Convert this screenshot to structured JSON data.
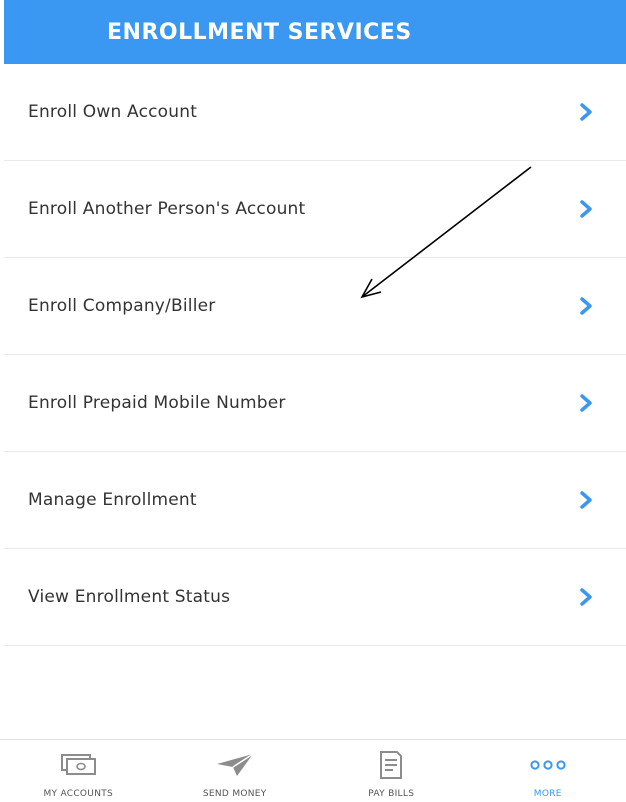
{
  "header": {
    "title": "ENROLLMENT SERVICES"
  },
  "menu": {
    "items": [
      {
        "label": "Enroll Own Account"
      },
      {
        "label": "Enroll Another Person's Account"
      },
      {
        "label": "Enroll Company/Biller"
      },
      {
        "label": "Enroll Prepaid Mobile Number"
      },
      {
        "label": "Manage Enrollment"
      },
      {
        "label": "View Enrollment Status"
      }
    ],
    "chevron_icon": "chevron-right-icon"
  },
  "tabbar": {
    "tabs": [
      {
        "label": "MY ACCOUNTS",
        "icon": "cash-icon",
        "active": false
      },
      {
        "label": "SEND MONEY",
        "icon": "paper-plane-icon",
        "active": false
      },
      {
        "label": "PAY BILLS",
        "icon": "bill-icon",
        "active": false
      },
      {
        "label": "MORE",
        "icon": "more-dots-icon",
        "active": true
      }
    ]
  },
  "colors": {
    "accent": "#3a98f2",
    "text": "#333333",
    "divider": "#e9e9e9",
    "tab_icon": "#8c8c8c"
  }
}
